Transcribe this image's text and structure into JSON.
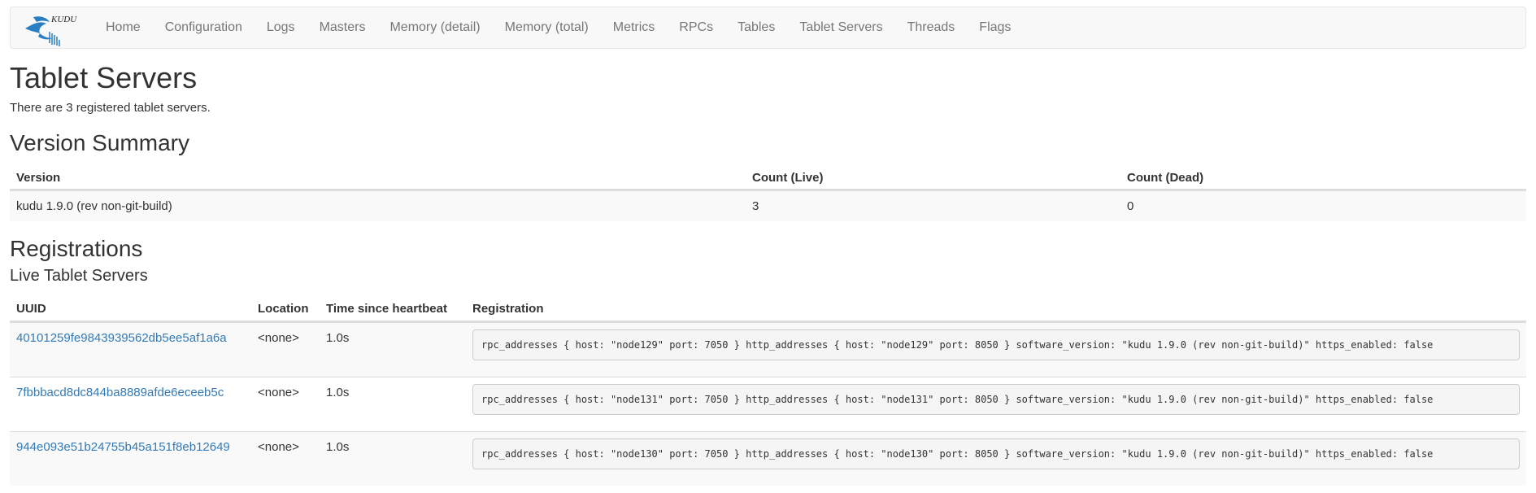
{
  "navbar": {
    "logo_text": "KUDU",
    "items": [
      {
        "label": "Home"
      },
      {
        "label": "Configuration"
      },
      {
        "label": "Logs"
      },
      {
        "label": "Masters"
      },
      {
        "label": "Memory (detail)"
      },
      {
        "label": "Memory (total)"
      },
      {
        "label": "Metrics"
      },
      {
        "label": "RPCs"
      },
      {
        "label": "Tables"
      },
      {
        "label": "Tablet Servers"
      },
      {
        "label": "Threads"
      },
      {
        "label": "Flags"
      }
    ]
  },
  "page": {
    "title": "Tablet Servers",
    "summary": "There are 3 registered tablet servers."
  },
  "version_summary": {
    "heading": "Version Summary",
    "columns": [
      "Version",
      "Count (Live)",
      "Count (Dead)"
    ],
    "rows": [
      {
        "version": "kudu 1.9.0 (rev non-git-build)",
        "live": "3",
        "dead": "0"
      }
    ]
  },
  "registrations": {
    "heading": "Registrations",
    "subheading": "Live Tablet Servers",
    "columns": [
      "UUID",
      "Location",
      "Time since heartbeat",
      "Registration"
    ],
    "rows": [
      {
        "uuid": "40101259fe9843939562db5ee5af1a6a",
        "location": "<none>",
        "heartbeat": "1.0s",
        "registration": "rpc_addresses { host: \"node129\" port: 7050 } http_addresses { host: \"node129\" port: 8050 } software_version: \"kudu 1.9.0 (rev non-git-build)\" https_enabled: false"
      },
      {
        "uuid": "7fbbbacd8dc844ba8889afde6eceeb5c",
        "location": "<none>",
        "heartbeat": "1.0s",
        "registration": "rpc_addresses { host: \"node131\" port: 7050 } http_addresses { host: \"node131\" port: 8050 } software_version: \"kudu 1.9.0 (rev non-git-build)\" https_enabled: false"
      },
      {
        "uuid": "944e093e51b24755b45a151f8eb12649",
        "location": "<none>",
        "heartbeat": "1.0s",
        "registration": "rpc_addresses { host: \"node130\" port: 7050 } http_addresses { host: \"node130\" port: 8050 } software_version: \"kudu 1.9.0 (rev non-git-build)\" https_enabled: false"
      }
    ]
  },
  "colors": {
    "link": "#337ab7",
    "logo_blue": "#2a7fc2",
    "navbar_bg": "#f8f8f8"
  }
}
